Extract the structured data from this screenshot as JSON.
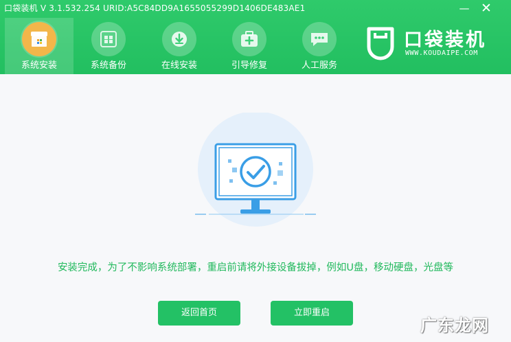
{
  "window": {
    "title": "口袋装机 V 3.1.532.254 URID:A5C84DD9A1655055299D1406DE483AE1",
    "minimize_glyph": "—",
    "close_glyph": "✕"
  },
  "nav": {
    "items": [
      {
        "label": "系统安装",
        "icon": "system-install-icon",
        "active": true
      },
      {
        "label": "系统备份",
        "icon": "system-backup-icon",
        "active": false
      },
      {
        "label": "在线安装",
        "icon": "online-install-icon",
        "active": false
      },
      {
        "label": "引导修复",
        "icon": "boot-repair-icon",
        "active": false
      },
      {
        "label": "人工服务",
        "icon": "chat-service-icon",
        "active": false
      }
    ]
  },
  "brand": {
    "name": "口袋装机",
    "url": "WWW.KOUDAIPE.COM"
  },
  "main": {
    "illustration": "monitor-check-icon",
    "message": "安装完成，为了不影响系统部署，重启前请将外接设备拔掉，例如U盘，移动硬盘，光盘等",
    "buttons": {
      "home": "返回首页",
      "restart": "立即重启"
    }
  },
  "watermark": "广东龙网",
  "colors": {
    "header": "#25c162",
    "accent": "#22b95d",
    "active_icon": "#f3b64a",
    "illustration_blue": "#3a9ee6"
  }
}
